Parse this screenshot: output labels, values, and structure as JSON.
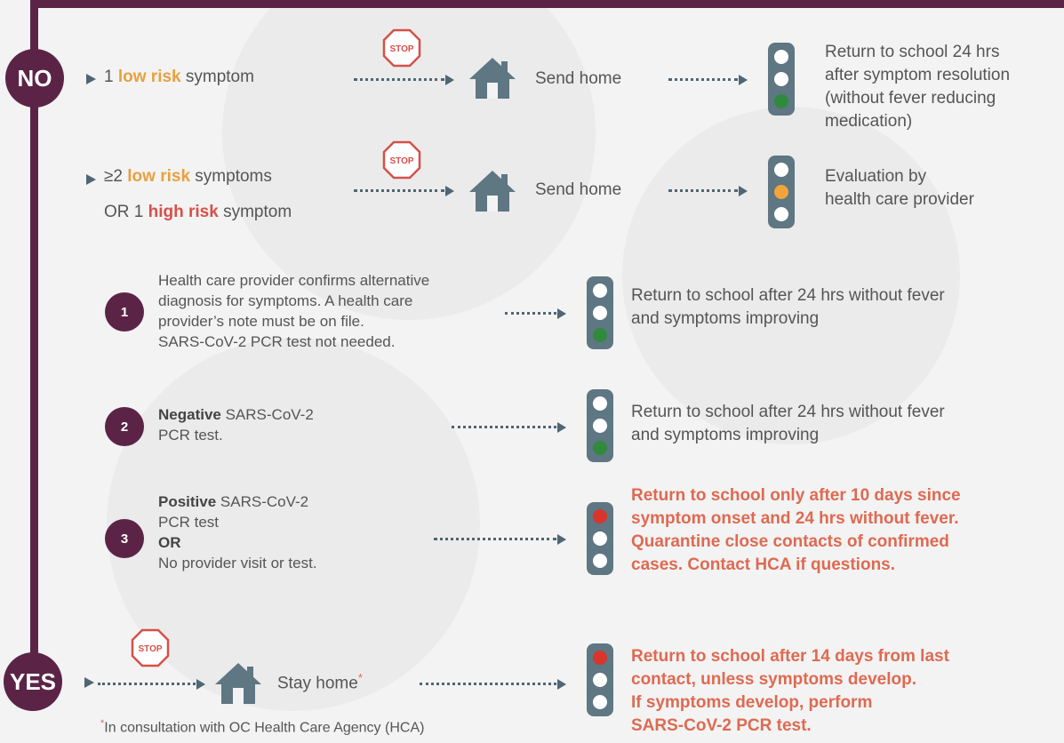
{
  "badges": {
    "no": "NO",
    "yes": "YES"
  },
  "stop_label": "STOP",
  "colors": {
    "purple": "#5b2447",
    "light_green": "#2f8a3e",
    "light_yellow": "#f0a43a",
    "light_red": "#d9352c",
    "arrow": "#4f6674",
    "low_risk": "#e8a040",
    "high_risk": "#d6504a"
  },
  "row1": {
    "prefix": "1 ",
    "emph": "low risk",
    "suffix": " symptom",
    "action": "Send home",
    "result": [
      "Return to school 24 hrs",
      "after symptom resolution",
      "(without fever reducing",
      "medication)"
    ]
  },
  "row2": {
    "line1_prefix": "≥2 ",
    "line1_emph": "low risk",
    "line1_suffix": " symptoms",
    "line2_prefix": "OR 1 ",
    "line2_emph": "high risk",
    "line2_suffix": " symptom",
    "action": "Send home",
    "result": [
      "Evaluation by",
      "health care provider"
    ]
  },
  "opt1": {
    "num": "1",
    "text": [
      "Health care provider confirms alternative",
      "diagnosis for symptoms. A health care",
      "provider’s note must be on file.",
      "SARS-CoV-2 PCR test not needed."
    ],
    "result": [
      "Return to school after 24 hrs without fever",
      "and symptoms improving"
    ]
  },
  "opt2": {
    "num": "2",
    "bold": "Negative",
    "text1": " SARS-CoV-2",
    "text2": "PCR test.",
    "result": [
      "Return to school after 24 hrs without fever",
      "and symptoms improving"
    ]
  },
  "opt3": {
    "num": "3",
    "bold": "Positive",
    "text1": " SARS-CoV-2",
    "text2": "PCR test",
    "or": "OR",
    "text3": "No provider visit or test.",
    "result": [
      "Return to school only after 10 days since",
      "symptom onset and 24 hrs without fever.",
      "Quarantine close contacts of confirmed",
      "cases. Contact HCA if questions."
    ]
  },
  "yes_row": {
    "action": "Stay home",
    "asterisk": "*",
    "result": [
      "Return to school after 14 days from last",
      "contact, unless symptoms develop.",
      "If symptoms develop, perform",
      "SARS-CoV-2 PCR test."
    ]
  },
  "footnote": {
    "star": "*",
    "text": "In consultation with OC Health Care Agency (HCA)"
  }
}
